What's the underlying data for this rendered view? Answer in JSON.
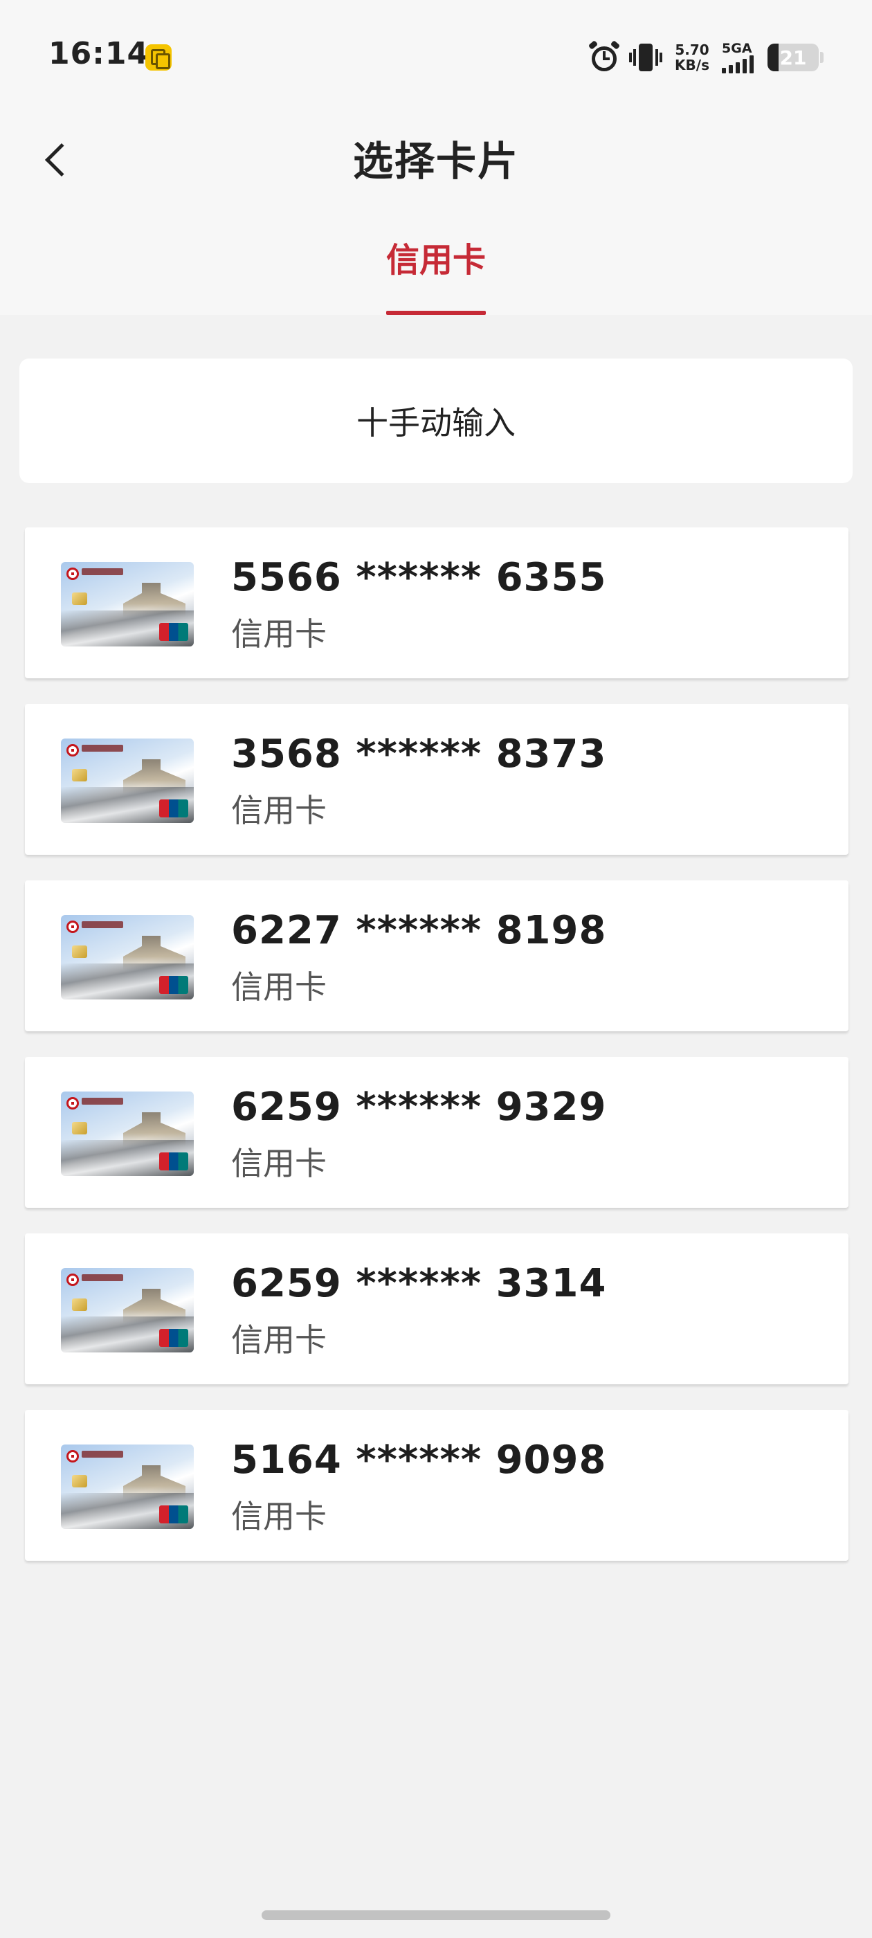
{
  "status_bar": {
    "time": "16:14",
    "net_speed_value": "5.70",
    "net_speed_unit": "KB/s",
    "signal_type": "5GA",
    "battery": "21",
    "battery_level": 0.21,
    "icons": [
      "notification-copy-icon",
      "alarm-icon",
      "vibrate-icon",
      "signal-icon",
      "battery-icon"
    ]
  },
  "header": {
    "title": "选择卡片",
    "back_icon": "chevron-left-icon"
  },
  "tabs": [
    {
      "label": "信用卡",
      "active": true
    }
  ],
  "manual_input": {
    "label": "十手动输入"
  },
  "cards": [
    {
      "number": "5566 ****** 6355",
      "type": "信用卡"
    },
    {
      "number": "3568 ****** 8373",
      "type": "信用卡"
    },
    {
      "number": "6227 ****** 8198",
      "type": "信用卡"
    },
    {
      "number": "6259 ****** 9329",
      "type": "信用卡"
    },
    {
      "number": "6259 ****** 3314",
      "type": "信用卡"
    },
    {
      "number": "5164 ****** 9098",
      "type": "信用卡"
    }
  ],
  "colors": {
    "accent": "#c62a36",
    "background": "#f2f2f2",
    "surface": "#ffffff"
  }
}
